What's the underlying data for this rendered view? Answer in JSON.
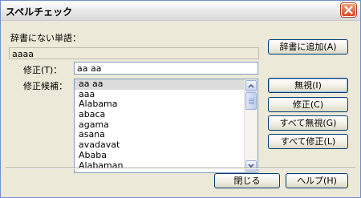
{
  "dialog": {
    "title": "スペルチェック",
    "not_in_dictionary_label": "辞書にない単語：",
    "not_in_dictionary_value": "aaaa",
    "correction_label": "修正(T)：",
    "correction_value": "aa aa",
    "suggestions_label": "修正候補：",
    "suggestions": [
      "aa aa",
      "aaa",
      "Alabama",
      "abaca",
      "agama",
      "asana",
      "avadavat",
      "Ababa",
      "Alabaman"
    ],
    "selected_suggestion": "aa aa"
  },
  "buttons": {
    "add_to_dictionary": "辞書に追加(A)",
    "ignore": "無視(I)",
    "correct": "修正(C)",
    "ignore_all": "すべて無視(G)",
    "correct_all": "すべて修正(L)",
    "close": "閉じる",
    "help": "ヘルプ(H)"
  },
  "icons": {
    "close": "close-icon",
    "scroll_up": "chevron-up-icon",
    "scroll_down": "chevron-down-icon"
  },
  "colors": {
    "dialog_bg": "#ece9d8",
    "close_button": "#d8492a",
    "selection": "#dcdcdc",
    "button_border": "#003c74"
  }
}
